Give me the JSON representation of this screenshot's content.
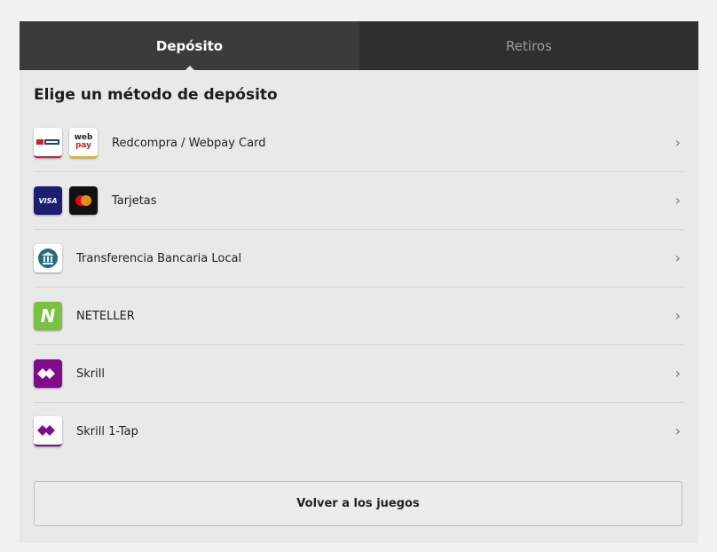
{
  "tabs": [
    {
      "label": "Depósito",
      "active": true
    },
    {
      "label": "Retiros",
      "active": false
    }
  ],
  "heading": "Elige un método de depósito",
  "methods": [
    {
      "label": "Redcompra / Webpay Card",
      "icons": [
        "redcompra-logo-icon",
        "webpay-logo-icon"
      ]
    },
    {
      "label": "Tarjetas",
      "icons": [
        "visa-logo-icon",
        "mastercard-logo-icon"
      ]
    },
    {
      "label": "Transferencia Bancaria Local",
      "icons": [
        "bank-icon"
      ]
    },
    {
      "label": "NETELLER",
      "icons": [
        "neteller-logo-icon"
      ]
    },
    {
      "label": "Skrill",
      "icons": [
        "skrill-logo-icon"
      ]
    },
    {
      "label": "Skrill 1-Tap",
      "icons": [
        "skrill-1-tap-logo-icon"
      ]
    }
  ],
  "chevron_icon": "chevron-right-icon",
  "back_button": "Volver a los juegos",
  "logo_text": {
    "visa": "VISA",
    "webpay_top": "web",
    "webpay_bottom": "pay",
    "neteller_letter": "N"
  },
  "colors": {
    "tab_bar": "#2f2f2f",
    "tab_active": "#3b3b3b",
    "panel": "#e9e9e9",
    "visa": "#1a1f71",
    "neteller": "#7ac142",
    "skrill": "#820a8c"
  }
}
